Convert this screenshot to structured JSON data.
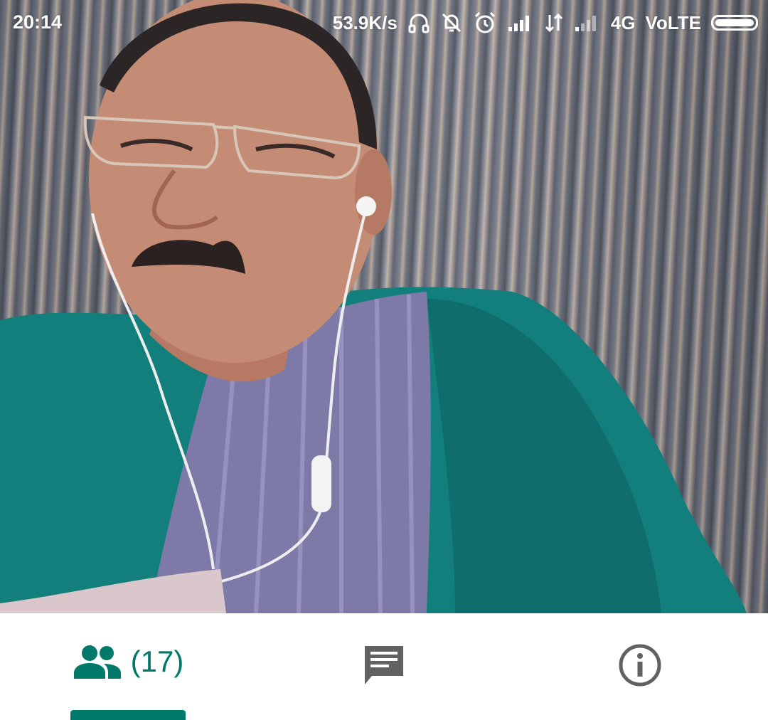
{
  "status_bar": {
    "time": "20:14",
    "network_speed": "53.9K/s",
    "network_type": "4G",
    "volte": "VoLTE",
    "icons": [
      "headset-icon",
      "notifications-off-icon",
      "alarm-icon",
      "signal-icon",
      "data-transfer-icon",
      "signal-weak-icon",
      "battery-icon"
    ]
  },
  "video": {
    "description_icon": "participant-video-feed"
  },
  "tabs": {
    "people": {
      "icon": "people-icon",
      "count_label": "(17)"
    },
    "chat": {
      "icon": "chat-icon"
    },
    "info": {
      "icon": "info-icon"
    },
    "active": "people"
  },
  "colors": {
    "accent": "#00796b",
    "icon_gray": "#616161",
    "status_text": "#ffffff"
  }
}
